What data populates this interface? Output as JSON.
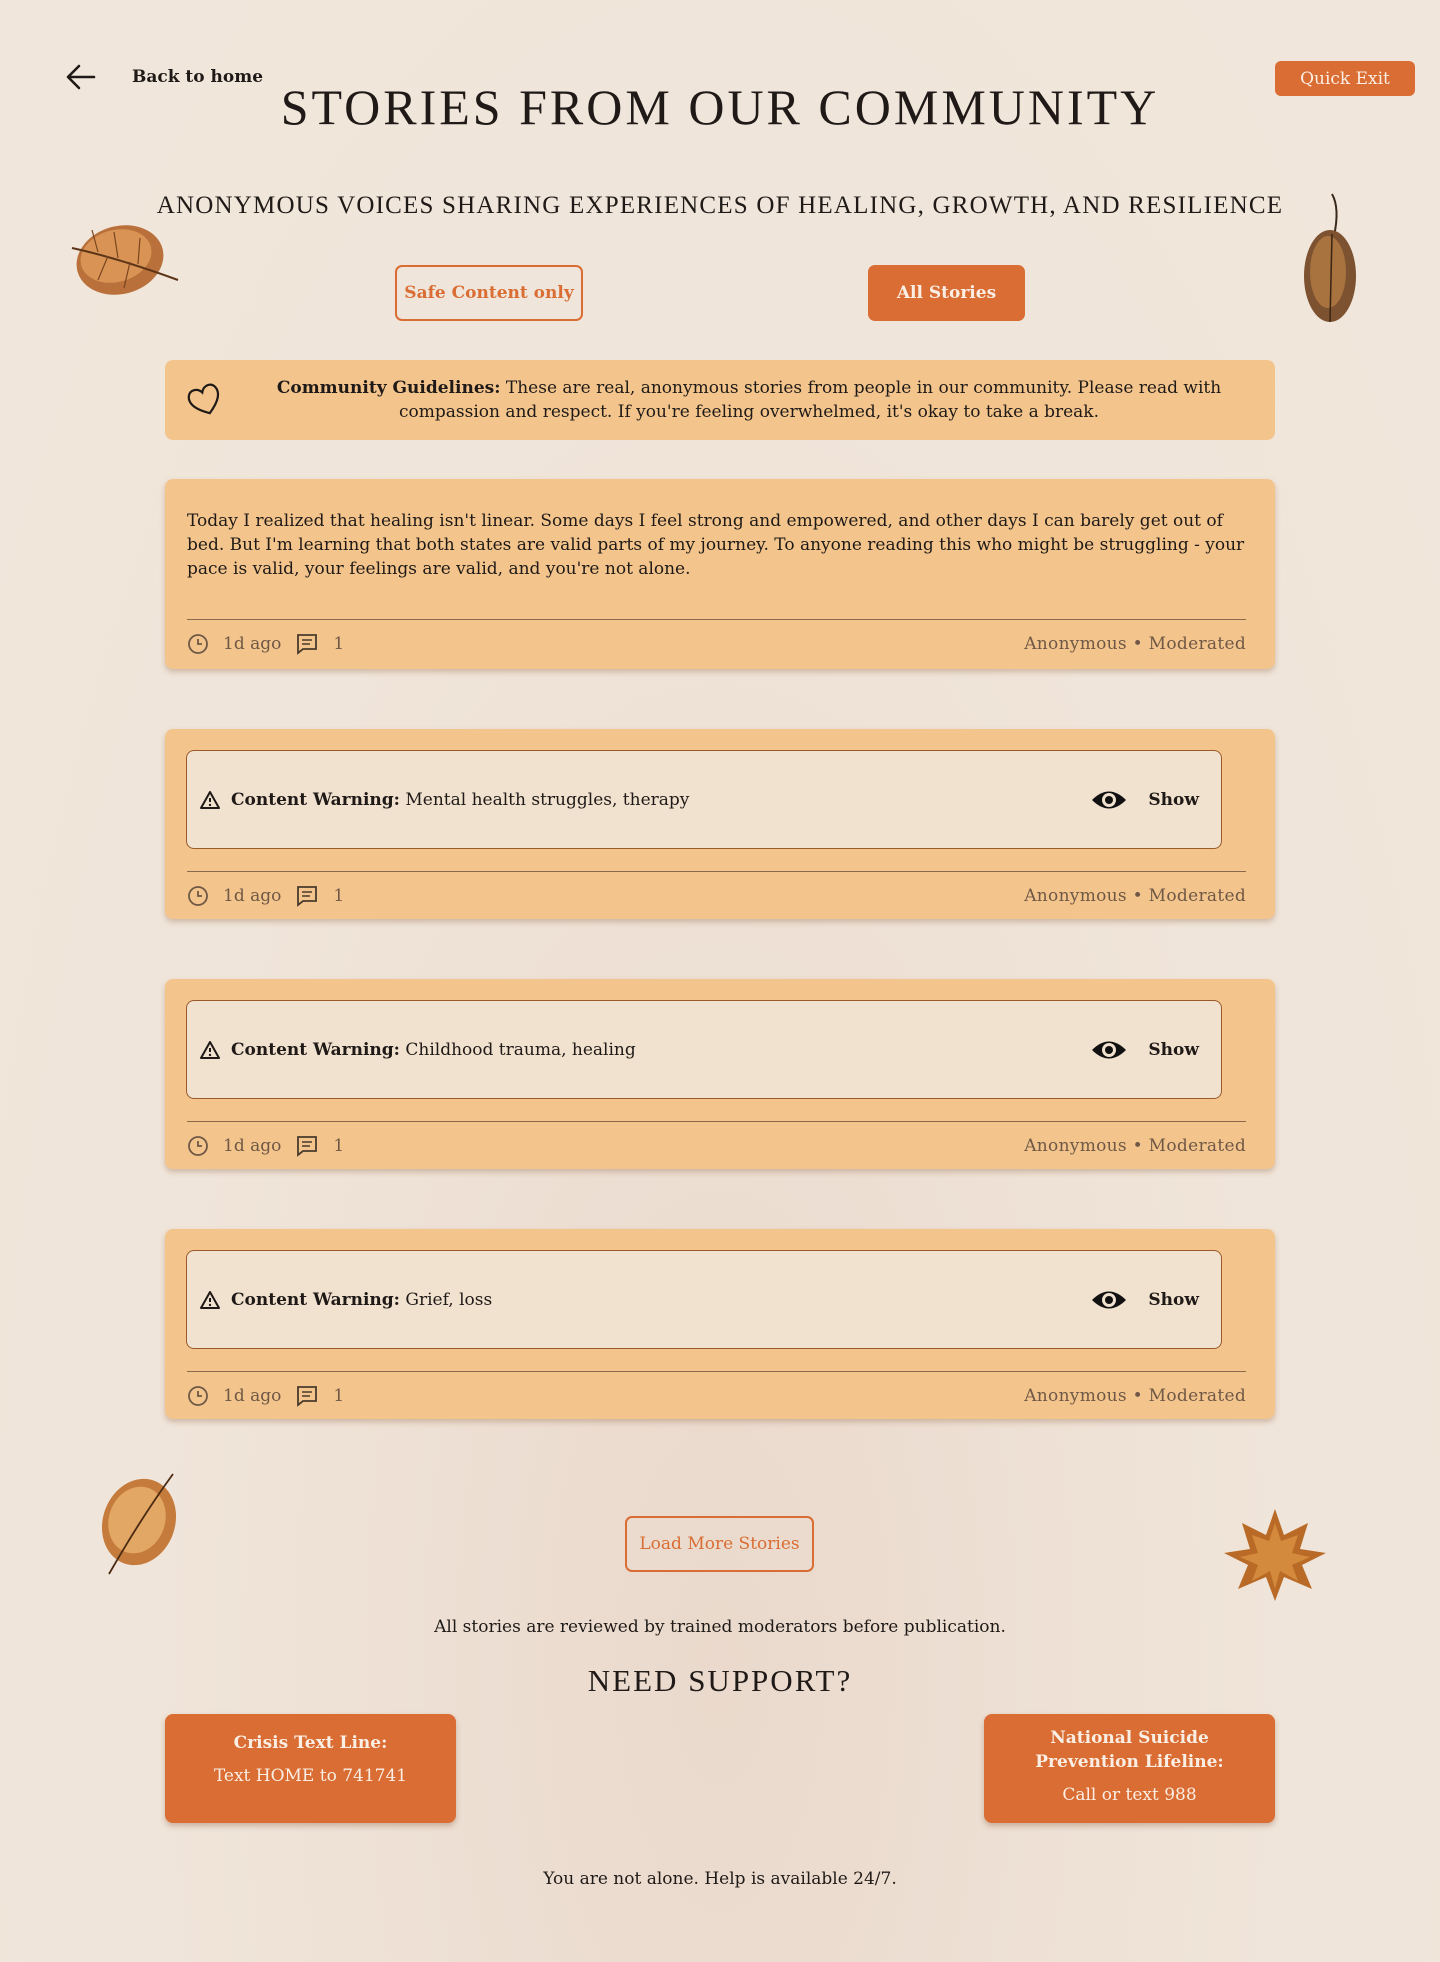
{
  "header": {
    "back_label": "Back to home",
    "quick_exit": "Quick Exit",
    "title": "STORIES FROM OUR COMMUNITY",
    "subtitle": "ANONYMOUS VOICES SHARING EXPERIENCES OF HEALING, GROWTH, AND RESILIENCE"
  },
  "filters": {
    "safe": "Safe Content only",
    "all": "All Stories"
  },
  "guidelines": {
    "label": "Community Guidelines:",
    "text": " These are real, anonymous stories from people in our community. Please read with compassion and respect. If you're feeling overwhelmed, it's okay to take a break."
  },
  "stories": [
    {
      "text": "Today I realized that healing isn't linear. Some days I feel strong and empowered, and other days I can barely get out of bed. But I'm learning that both states are valid parts of my journey. To anyone reading this who might be struggling - your pace is valid, your feelings are valid, and you're not alone.",
      "time": "1d ago",
      "comments": "1",
      "author": "Anonymous • Moderated"
    },
    {
      "warning_label": "Content Warning:",
      "warning": " Mental health struggles, therapy",
      "show": "Show",
      "time": "1d ago",
      "comments": "1",
      "author": "Anonymous • Moderated"
    },
    {
      "warning_label": "Content Warning:",
      "warning": " Childhood trauma, healing",
      "show": "Show",
      "time": "1d ago",
      "comments": "1",
      "author": "Anonymous • Moderated"
    },
    {
      "warning_label": "Content Warning:",
      "warning": " Grief, loss",
      "show": "Show",
      "time": "1d ago",
      "comments": "1",
      "author": "Anonymous • Moderated"
    }
  ],
  "load_more": "Load More Stories",
  "moderation_note": "All stories are reviewed by trained moderators before publication.",
  "support": {
    "title": "NEED SUPPORT?",
    "crisis_title": "Crisis Text Line:",
    "crisis_desc": "Text HOME to 741741",
    "lifeline_title": "National Suicide Prevention Lifeline:",
    "lifeline_desc": "Call or text 988"
  },
  "footer_note": "You are not alone. Help is available 24/7.",
  "colors": {
    "accent": "#d96d33",
    "card": "#f3c58d",
    "background": "#f0e5da"
  }
}
